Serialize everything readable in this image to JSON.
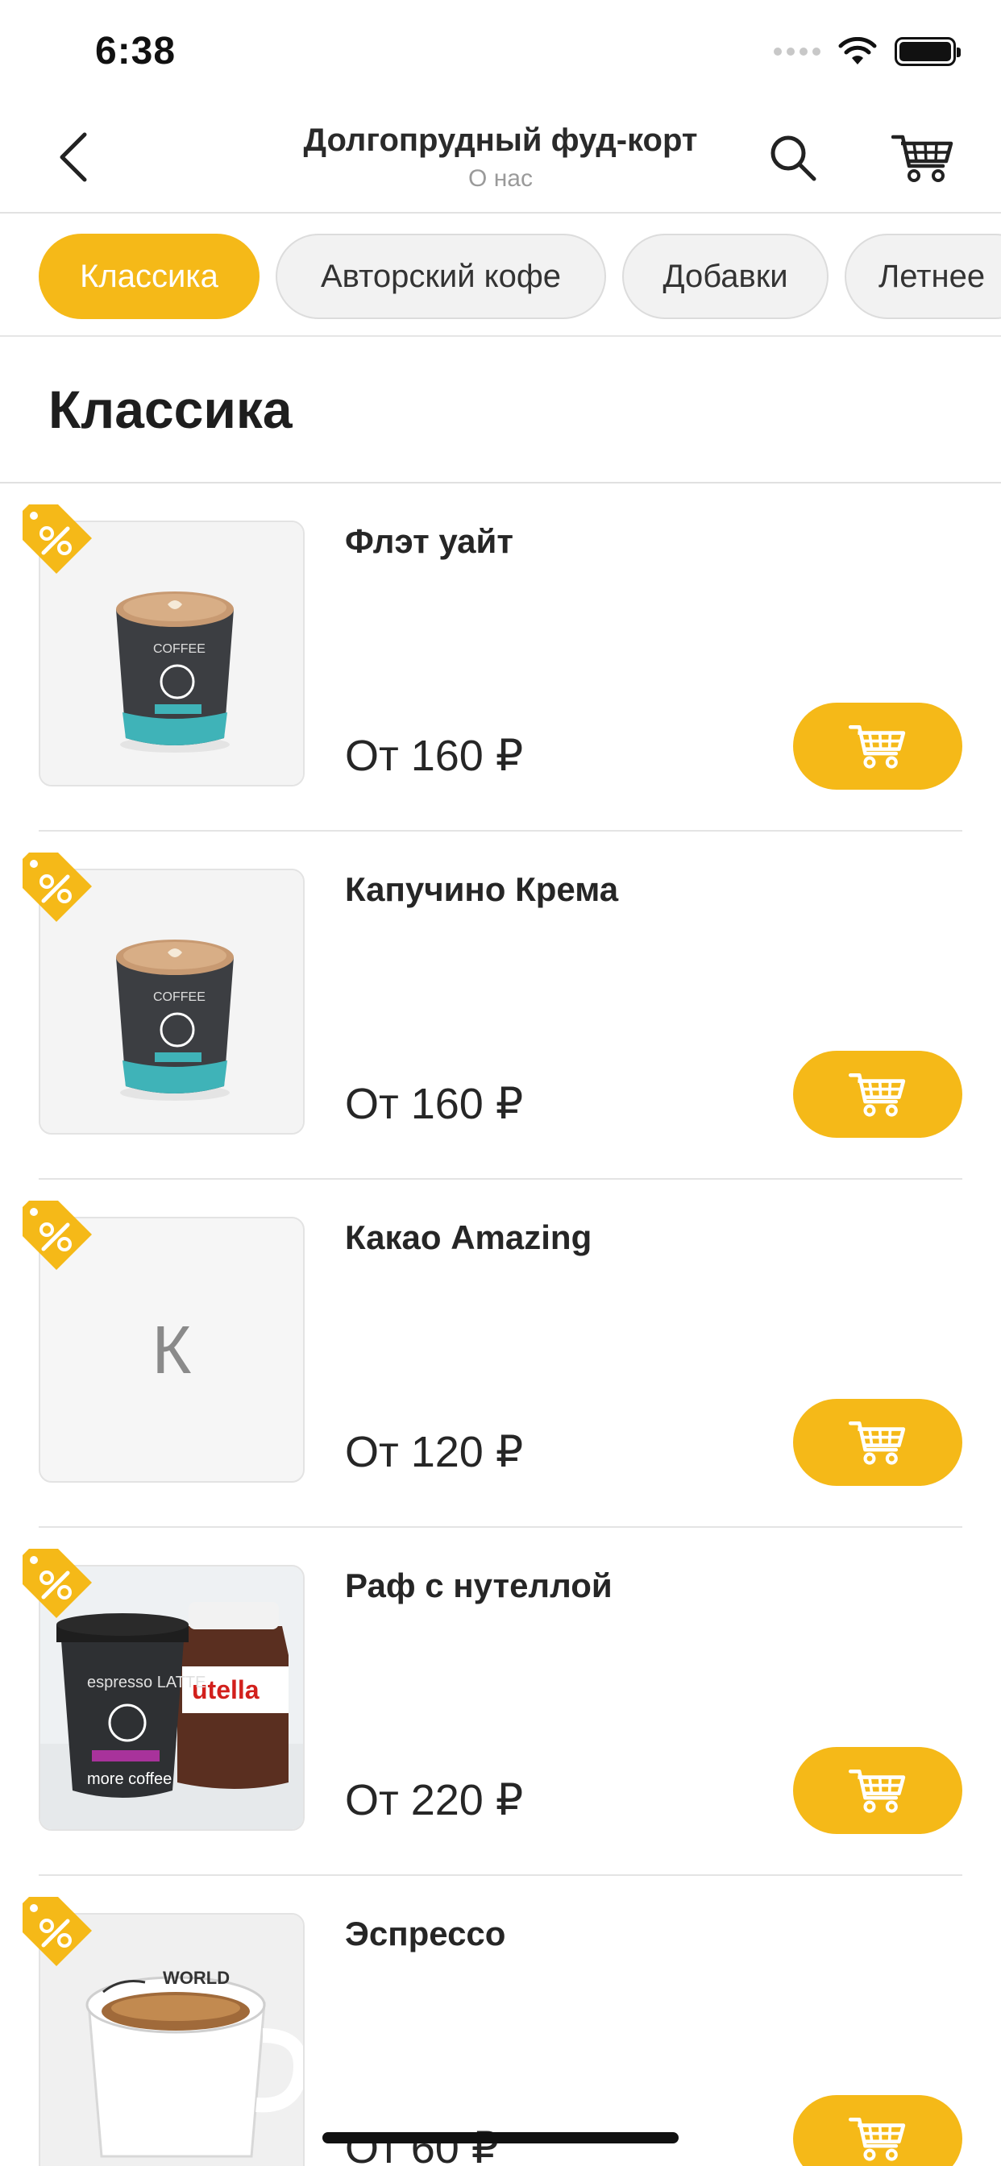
{
  "status_bar": {
    "time": "6:38"
  },
  "header": {
    "title": "Долгопрудный фуд-корт",
    "subtitle": "О нас"
  },
  "categories": [
    {
      "label": "Классика",
      "active": true
    },
    {
      "label": "Авторский кофе",
      "active": false
    },
    {
      "label": "Добавки",
      "active": false
    },
    {
      "label": "Летнее",
      "active": false
    }
  ],
  "section": {
    "title": "Классика"
  },
  "products": [
    {
      "name": "Флэт уайт",
      "price": "От 160 ₽",
      "image": "coffee-cup",
      "placeholder_letter": ""
    },
    {
      "name": "Капучино Крема",
      "price": "От 160 ₽",
      "image": "coffee-cup",
      "placeholder_letter": ""
    },
    {
      "name": "Какао Amazing",
      "price": "От 120 ₽",
      "image": "placeholder",
      "placeholder_letter": "К"
    },
    {
      "name": "Раф с нутеллой",
      "price": "От 220 ₽",
      "image": "takeaway-cup-with-jar",
      "placeholder_letter": ""
    },
    {
      "name": "Эспрессо",
      "price": "От 60 ₽",
      "image": "espresso-mug",
      "placeholder_letter": ""
    }
  ],
  "colors": {
    "accent": "#f5b918",
    "chip_inactive": "#f2f2f2",
    "divider": "#e4e4e4"
  },
  "icons": {
    "back": "chevron-left-icon",
    "search": "search-icon",
    "cart": "cart-icon",
    "promo": "percent-tag-icon"
  }
}
